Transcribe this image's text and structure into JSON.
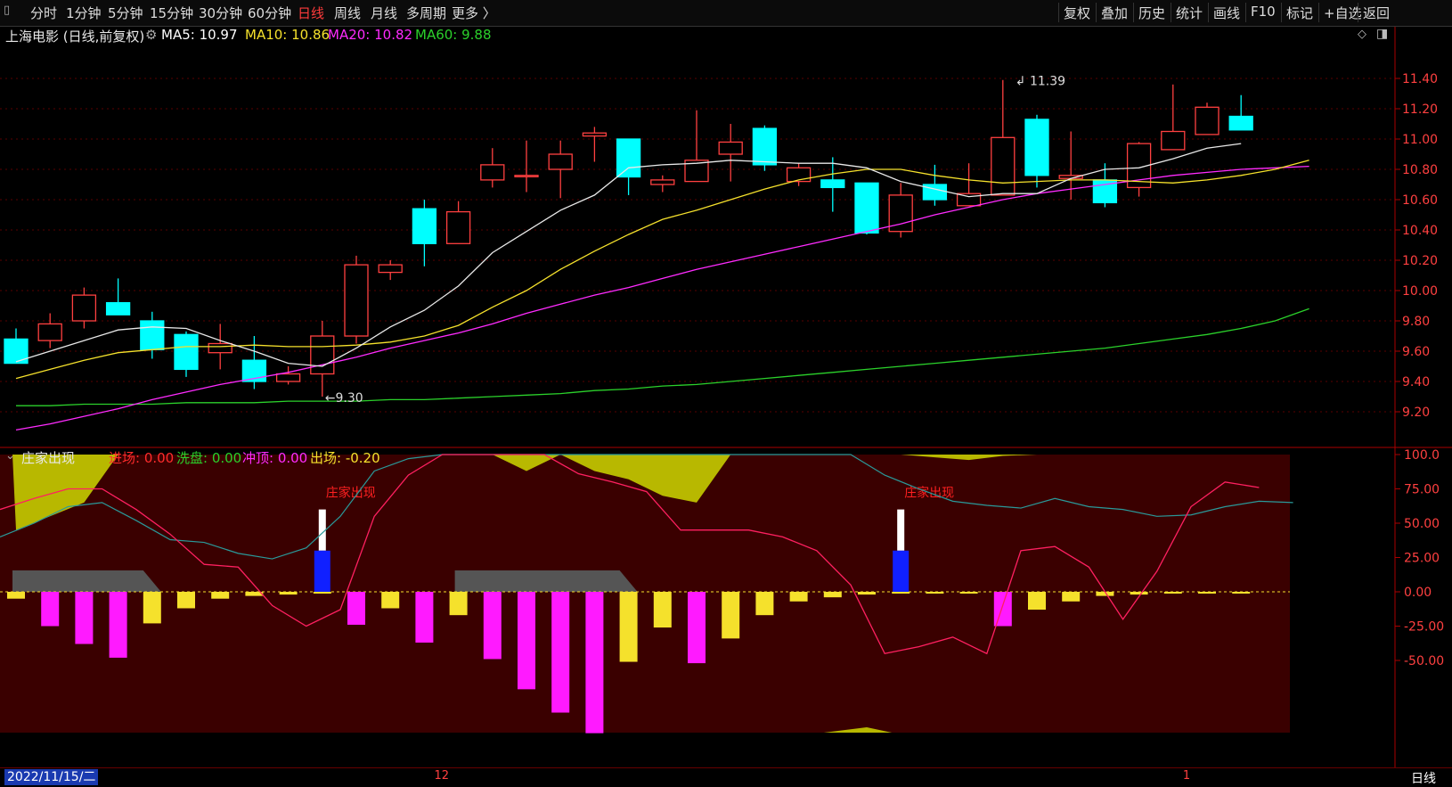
{
  "toolbar": {
    "items": [
      "分时",
      "1分钟",
      "5分钟",
      "15分钟",
      "30分钟",
      "60分钟",
      "日线",
      "周线",
      "月线",
      "多周期",
      "更多 〉"
    ],
    "active": "日线",
    "right_items": [
      "复权",
      "叠加",
      "历史",
      "统计",
      "画线",
      "F10",
      "标记",
      "+自选",
      "返回"
    ]
  },
  "main_chart": {
    "title": "上海电影 (日线,前复权)",
    "ma": [
      {
        "label": "MA5: 10.97",
        "color": "#ffffff"
      },
      {
        "label": "MA10: 10.86",
        "color": "#f5e12c"
      },
      {
        "label": "MA20: 10.82",
        "color": "#ff2bff"
      },
      {
        "label": "MA60: 9.88",
        "color": "#2bd12b"
      }
    ],
    "high_label": "11.39",
    "low_label": "9.30",
    "y_ticks": [
      "11.40",
      "11.20",
      "11.00",
      "10.80",
      "10.60",
      "10.40",
      "10.20",
      "10.00",
      "9.80",
      "9.60",
      "9.40",
      "9.20"
    ],
    "candles": [
      {
        "o": 9.68,
        "h": 9.75,
        "l": 9.52,
        "c": 9.52
      },
      {
        "o": 9.67,
        "h": 9.85,
        "l": 9.62,
        "c": 9.78
      },
      {
        "o": 9.8,
        "h": 10.02,
        "l": 9.75,
        "c": 9.97
      },
      {
        "o": 9.92,
        "h": 10.08,
        "l": 9.85,
        "c": 9.84
      },
      {
        "o": 9.8,
        "h": 9.86,
        "l": 9.55,
        "c": 9.61
      },
      {
        "o": 9.71,
        "h": 9.73,
        "l": 9.43,
        "c": 9.48
      },
      {
        "o": 9.59,
        "h": 9.78,
        "l": 9.48,
        "c": 9.65
      },
      {
        "o": 9.54,
        "h": 9.7,
        "l": 9.35,
        "c": 9.4
      },
      {
        "o": 9.4,
        "h": 9.5,
        "l": 9.38,
        "c": 9.45
      },
      {
        "o": 9.45,
        "h": 9.8,
        "l": 9.3,
        "c": 9.7
      },
      {
        "o": 9.7,
        "h": 10.23,
        "l": 9.65,
        "c": 10.17
      },
      {
        "o": 10.12,
        "h": 10.2,
        "l": 10.07,
        "c": 10.17
      },
      {
        "o": 10.54,
        "h": 10.6,
        "l": 10.16,
        "c": 10.31
      },
      {
        "o": 10.31,
        "h": 10.59,
        "l": 10.31,
        "c": 10.52
      },
      {
        "o": 10.73,
        "h": 10.94,
        "l": 10.68,
        "c": 10.83
      },
      {
        "o": 10.76,
        "h": 10.99,
        "l": 10.65,
        "c": 10.76
      },
      {
        "o": 10.8,
        "h": 10.99,
        "l": 10.61,
        "c": 10.9
      },
      {
        "o": 11.02,
        "h": 11.08,
        "l": 10.85,
        "c": 11.04
      },
      {
        "o": 11.0,
        "h": 11.0,
        "l": 10.63,
        "c": 10.75
      },
      {
        "o": 10.7,
        "h": 10.76,
        "l": 10.65,
        "c": 10.73
      },
      {
        "o": 10.72,
        "h": 11.19,
        "l": 10.72,
        "c": 10.86
      },
      {
        "o": 10.9,
        "h": 11.1,
        "l": 10.72,
        "c": 10.98
      },
      {
        "o": 11.07,
        "h": 11.09,
        "l": 10.79,
        "c": 10.83
      },
      {
        "o": 10.72,
        "h": 10.84,
        "l": 10.69,
        "c": 10.81
      },
      {
        "o": 10.73,
        "h": 10.88,
        "l": 10.52,
        "c": 10.68
      },
      {
        "o": 10.71,
        "h": 10.7,
        "l": 10.37,
        "c": 10.38
      },
      {
        "o": 10.39,
        "h": 10.71,
        "l": 10.35,
        "c": 10.63
      },
      {
        "o": 10.7,
        "h": 10.83,
        "l": 10.56,
        "c": 10.6
      },
      {
        "o": 10.56,
        "h": 10.84,
        "l": 10.56,
        "c": 10.64
      },
      {
        "o": 10.63,
        "h": 11.39,
        "l": 10.63,
        "c": 11.01
      },
      {
        "o": 11.13,
        "h": 11.16,
        "l": 10.68,
        "c": 10.76
      },
      {
        "o": 10.74,
        "h": 11.05,
        "l": 10.6,
        "c": 10.76
      },
      {
        "o": 10.73,
        "h": 10.84,
        "l": 10.55,
        "c": 10.58
      },
      {
        "o": 10.68,
        "h": 10.98,
        "l": 10.62,
        "c": 10.97
      },
      {
        "o": 10.93,
        "h": 11.36,
        "l": 10.93,
        "c": 11.05
      },
      {
        "o": 11.03,
        "h": 11.24,
        "l": 11.03,
        "c": 11.21
      },
      {
        "o": 11.15,
        "h": 11.29,
        "l": 11.09,
        "c": 11.06
      }
    ],
    "ma5": [
      9.53,
      9.6,
      9.67,
      9.74,
      9.76,
      9.75,
      9.67,
      9.6,
      9.52,
      9.5,
      9.62,
      9.76,
      9.87,
      10.03,
      10.25,
      10.39,
      10.53,
      10.63,
      10.81,
      10.83,
      10.84,
      10.86,
      10.85,
      10.84,
      10.84,
      10.81,
      10.72,
      10.67,
      10.62,
      10.64,
      10.64,
      10.74,
      10.8,
      10.81,
      10.87,
      10.94,
      10.97
    ],
    "ma10": [
      9.42,
      9.48,
      9.54,
      9.59,
      9.61,
      9.63,
      9.63,
      9.64,
      9.63,
      9.63,
      9.64,
      9.66,
      9.7,
      9.77,
      9.89,
      10.0,
      10.14,
      10.26,
      10.37,
      10.47,
      10.53,
      10.6,
      10.67,
      10.73,
      10.77,
      10.8,
      10.8,
      10.76,
      10.73,
      10.71,
      10.72,
      10.73,
      10.73,
      10.72,
      10.71,
      10.73,
      10.76,
      10.8,
      10.86
    ],
    "ma20": [
      9.08,
      9.12,
      9.17,
      9.22,
      9.28,
      9.33,
      9.38,
      9.42,
      9.46,
      9.51,
      9.56,
      9.62,
      9.67,
      9.72,
      9.78,
      9.85,
      9.91,
      9.97,
      10.02,
      10.08,
      10.14,
      10.19,
      10.24,
      10.29,
      10.34,
      10.39,
      10.44,
      10.5,
      10.55,
      10.6,
      10.64,
      10.67,
      10.7,
      10.73,
      10.76,
      10.78,
      10.8,
      10.81,
      10.82
    ],
    "ma60": [
      9.24,
      9.24,
      9.25,
      9.25,
      9.25,
      9.26,
      9.26,
      9.26,
      9.27,
      9.27,
      9.27,
      9.28,
      9.28,
      9.29,
      9.3,
      9.31,
      9.32,
      9.34,
      9.35,
      9.37,
      9.38,
      9.4,
      9.42,
      9.44,
      9.46,
      9.48,
      9.5,
      9.52,
      9.54,
      9.56,
      9.58,
      9.6,
      9.62,
      9.65,
      9.68,
      9.71,
      9.75,
      9.8,
      9.88
    ]
  },
  "sub_chart": {
    "title": "庄家出现",
    "labels": [
      {
        "text": "进场: 0.00",
        "color": "#ff2b2b"
      },
      {
        "text": "洗盘: 0.00",
        "color": "#2bd12b"
      },
      {
        "text": "冲顶: 0.00",
        "color": "#ff2bff"
      },
      {
        "text": "出场: -0.20",
        "color": "#f5e12c"
      }
    ],
    "signal_text": "庄家出现",
    "signal_bars": [
      9,
      26
    ],
    "y_ticks": [
      "100.0",
      "75.00",
      "50.00",
      "25.00",
      "0.00",
      "-25.00",
      "-50.00"
    ],
    "bars": [
      -5,
      -25,
      -38,
      -48,
      -23,
      -12,
      -5,
      -3,
      -2,
      -1,
      -24,
      -12,
      -37,
      -17,
      -49,
      -71,
      -88,
      -103,
      -51,
      -26,
      -52,
      -34,
      -17,
      -7,
      -4,
      -2,
      0,
      0,
      0,
      -25,
      -13,
      -7,
      -3,
      -2,
      -1,
      -1,
      -1
    ],
    "red_line": [
      60,
      68,
      75,
      75,
      60,
      42,
      20,
      18,
      -10,
      -25,
      -13,
      55,
      85,
      100,
      100,
      100,
      100,
      86,
      80,
      73,
      45,
      45,
      45,
      40,
      30,
      5,
      -45,
      -40,
      -33,
      -45,
      30,
      33,
      18,
      -20,
      15,
      62,
      80,
      76
    ],
    "teal_line": [
      40,
      50,
      62,
      65,
      52,
      38,
      36,
      28,
      24,
      32,
      55,
      88,
      97,
      100,
      100,
      100,
      100,
      100,
      100,
      100,
      100,
      100,
      100,
      100,
      100,
      100,
      85,
      75,
      66,
      63,
      61,
      68,
      62,
      60,
      55,
      56,
      62,
      66,
      65
    ],
    "yellow_area": [
      45,
      55,
      65,
      100,
      100,
      100,
      100,
      100,
      100,
      100,
      100,
      100,
      100,
      100,
      100,
      88,
      100,
      88,
      82,
      70,
      65,
      100,
      100,
      100,
      100,
      100,
      100,
      98,
      96,
      99,
      100,
      100,
      100,
      100,
      100,
      100,
      100,
      100
    ],
    "gray_blocks": [
      [
        0,
        4
      ],
      [
        13,
        18
      ]
    ]
  },
  "bottom": {
    "date": "2022/11/15/二",
    "ticks": [
      {
        "text": "12",
        "pos": 12.5
      },
      {
        "text": "1",
        "pos": 34.5
      }
    ],
    "period": "日线"
  }
}
